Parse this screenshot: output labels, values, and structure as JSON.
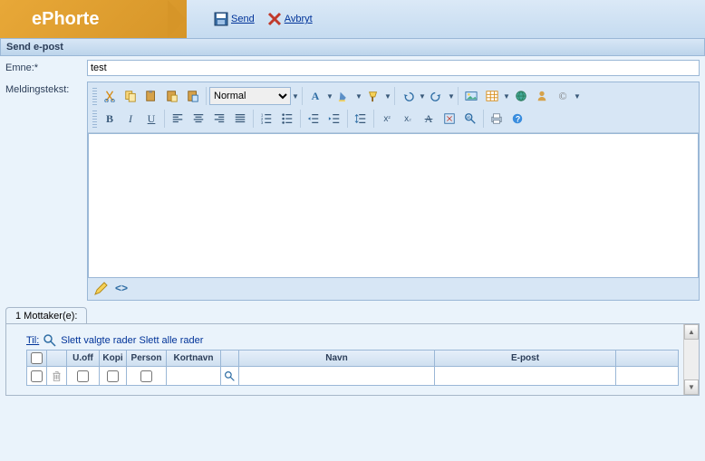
{
  "app": {
    "name": "ePhorte"
  },
  "header": {
    "send": "Send",
    "cancel": "Avbryt"
  },
  "section": {
    "title": "Send e-post"
  },
  "form": {
    "subject_label": "Emne:*",
    "subject_value": "test",
    "body_label": "Meldingstekst:"
  },
  "editor": {
    "style_select": "Normal"
  },
  "recipients": {
    "tab_label": "1 Mottaker(e):",
    "til_label": "Til:",
    "delete_selected": "Slett valgte rader",
    "delete_all": "Slett alle rader",
    "columns": {
      "uoff": "U.off",
      "kopi": "Kopi",
      "person": "Person",
      "kortnavn": "Kortnavn",
      "navn": "Navn",
      "epost": "E-post"
    }
  }
}
